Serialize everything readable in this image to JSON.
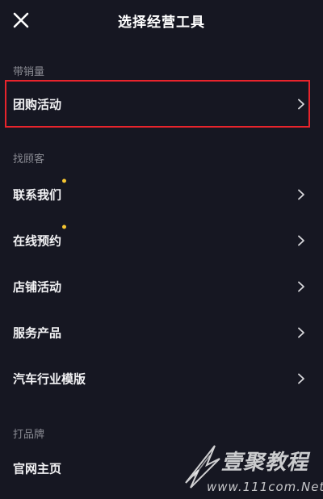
{
  "header": {
    "title": "选择经营工具"
  },
  "sections": [
    {
      "title": "带销量",
      "items": [
        {
          "label": "团购活动",
          "dot": false
        }
      ]
    },
    {
      "title": "找顾客",
      "items": [
        {
          "label": "联系我们",
          "dot": true
        },
        {
          "label": "在线预约",
          "dot": true
        },
        {
          "label": "店铺活动",
          "dot": false
        },
        {
          "label": "服务产品",
          "dot": false
        },
        {
          "label": "汽车行业模版",
          "dot": false
        }
      ]
    },
    {
      "title": "打品牌",
      "items": [
        {
          "label": "官网主页",
          "dot": false
        }
      ]
    }
  ],
  "colors": {
    "background": "#161722",
    "highlight": "#e8242c",
    "dot": "#f5c531"
  },
  "watermark": {
    "brand": "壹聚教程",
    "url": "www.111com.Net"
  }
}
